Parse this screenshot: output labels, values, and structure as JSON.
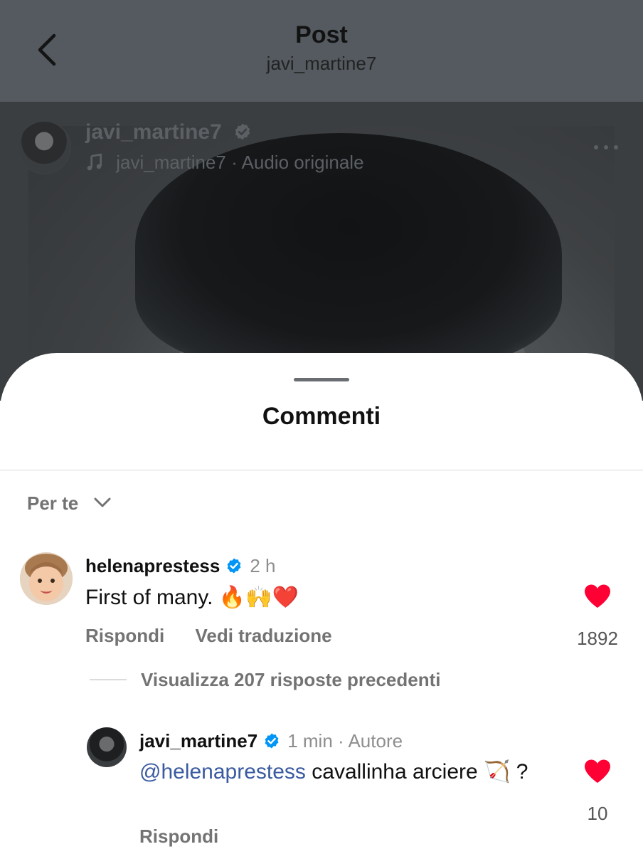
{
  "header": {
    "title": "Post",
    "subtitle": "javi_martine7"
  },
  "post": {
    "username": "javi_martine7",
    "audio_label": "javi_martine7 · Audio originale"
  },
  "comments_sheet": {
    "title": "Commenti",
    "sort_label": "Per te"
  },
  "comment": {
    "username": "helenaprestess",
    "time": "2 h",
    "text": "First of many. 🔥🙌❤️",
    "reply_label": "Rispondi",
    "translate_label": "Vedi traduzione",
    "likes": "1892"
  },
  "view_replies_label": "Visualizza 207 risposte precedenti",
  "reply": {
    "username": "javi_martine7",
    "meta": "1 min · Autore",
    "mention": "@helenaprestess",
    "text": " cavallinha arciere 🏹 ?",
    "reply_label": "Rispondi",
    "likes": "10"
  },
  "colors": {
    "like_red": "#ff0035",
    "verified_blue": "#0095f6",
    "mention_blue": "#3a5ba0"
  }
}
